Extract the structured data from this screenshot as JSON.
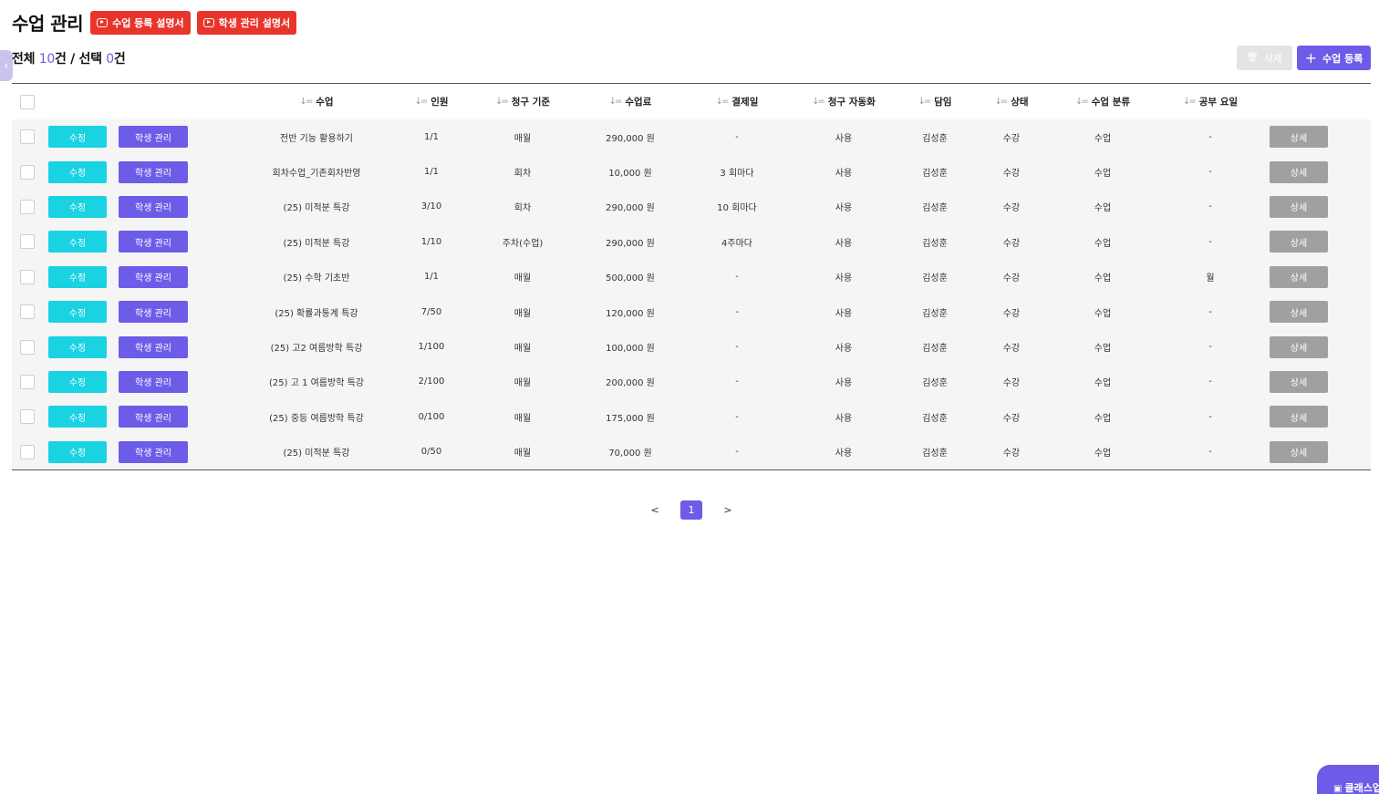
{
  "header": {
    "title": "수업 관리",
    "manual_buttons": [
      "수업 등록 설명서",
      "학생 관리 설명서"
    ]
  },
  "summary": {
    "total_label": "전체",
    "total_count": "10",
    "unit": "건",
    "separator": " / ",
    "selected_label": "선택",
    "selected_count": "0"
  },
  "toolbar": {
    "delete_label": "삭제",
    "add_label": "수업 등록"
  },
  "table": {
    "columns": [
      "수업",
      "인원",
      "청구 기준",
      "수업료",
      "결제일",
      "청구 자동화",
      "담임",
      "상태",
      "수업 분류",
      "공부 요일"
    ],
    "edit_label": "수정",
    "student_label": "학생 관리",
    "detail_label": "상세",
    "rows": [
      {
        "name": "전반 기능 활용하기",
        "people": "1/1",
        "billing": "매월",
        "fee": "290,000 원",
        "payday": "-",
        "auto": "사용",
        "teacher": "김성훈",
        "status": "수강",
        "category": "수업",
        "days": "-"
      },
      {
        "name": "회차수업_기존회차반영",
        "people": "1/1",
        "billing": "회차",
        "fee": "10,000 원",
        "payday": "3 회마다",
        "auto": "사용",
        "teacher": "김성훈",
        "status": "수강",
        "category": "수업",
        "days": "-"
      },
      {
        "name": "(25) 미적분 특강",
        "people": "3/10",
        "billing": "회차",
        "fee": "290,000 원",
        "payday": "10 회마다",
        "auto": "사용",
        "teacher": "김성훈",
        "status": "수강",
        "category": "수업",
        "days": "-"
      },
      {
        "name": "(25) 미적분 특강",
        "people": "1/10",
        "billing": "주차(수업)",
        "fee": "290,000 원",
        "payday": "4주마다",
        "auto": "사용",
        "teacher": "김성훈",
        "status": "수강",
        "category": "수업",
        "days": "-"
      },
      {
        "name": "(25) 수학 기초반",
        "people": "1/1",
        "billing": "매월",
        "fee": "500,000 원",
        "payday": "-",
        "auto": "사용",
        "teacher": "김성훈",
        "status": "수강",
        "category": "수업",
        "days": "월"
      },
      {
        "name": "(25) 확률과통계 특강",
        "people": "7/50",
        "billing": "매월",
        "fee": "120,000 원",
        "payday": "-",
        "auto": "사용",
        "teacher": "김성훈",
        "status": "수강",
        "category": "수업",
        "days": "-"
      },
      {
        "name": "(25) 고2 여름방학 특강",
        "people": "1/100",
        "billing": "매월",
        "fee": "100,000 원",
        "payday": "-",
        "auto": "사용",
        "teacher": "김성훈",
        "status": "수강",
        "category": "수업",
        "days": "-"
      },
      {
        "name": "(25) 고 1 여름방학 특강",
        "people": "2/100",
        "billing": "매월",
        "fee": "200,000 원",
        "payday": "-",
        "auto": "사용",
        "teacher": "김성훈",
        "status": "수강",
        "category": "수업",
        "days": "-"
      },
      {
        "name": "(25) 중등 여름방학 특강",
        "people": "0/100",
        "billing": "매월",
        "fee": "175,000 원",
        "payday": "-",
        "auto": "사용",
        "teacher": "김성훈",
        "status": "수강",
        "category": "수업",
        "days": "-"
      },
      {
        "name": "(25) 미적분 특강",
        "people": "0/50",
        "billing": "매월",
        "fee": "70,000 원",
        "payday": "-",
        "auto": "사용",
        "teacher": "김성훈",
        "status": "수강",
        "category": "수업",
        "days": "-"
      }
    ]
  },
  "pagination": {
    "prev": "<",
    "current": "1",
    "next": ">"
  },
  "floating_button": {
    "label": "클래스업"
  },
  "colors": {
    "accent": "#6c5ce7",
    "edit": "#19d2e2",
    "manual": "#e8352b",
    "detail": "#a0a0a0"
  }
}
